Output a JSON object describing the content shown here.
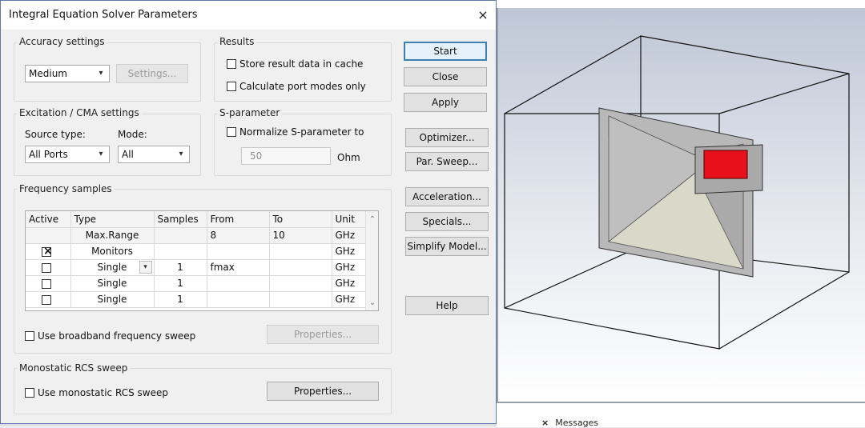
{
  "dialog": {
    "title": "Integral Equation Solver Parameters",
    "close_icon": "×"
  },
  "accuracy": {
    "label": "Accuracy settings",
    "value": "Medium",
    "settings_button": "Settings..."
  },
  "excitation": {
    "label": "Excitation / CMA settings",
    "source_type_label": "Source type:",
    "source_type_value": "All Ports",
    "mode_label": "Mode:",
    "mode_value": "All"
  },
  "results": {
    "label": "Results",
    "store_cache": "Store result data in cache",
    "calc_port_modes": "Calculate port modes only"
  },
  "sparameter": {
    "label": "S-parameter",
    "normalize_label": "Normalize S-parameter to",
    "value": "50",
    "unit": "Ohm"
  },
  "frequency": {
    "label": "Frequency samples",
    "columns": [
      "Active",
      "Type",
      "Samples",
      "From",
      "To",
      "Unit"
    ],
    "rows": [
      {
        "type": "Max.Range",
        "samples": "",
        "from": "8",
        "to": "10",
        "unit": "GHz"
      },
      {
        "type": "Monitors",
        "samples": "",
        "from": "",
        "to": "",
        "unit": "GHz",
        "checked": true
      },
      {
        "type": "Single",
        "samples": "1",
        "from": "fmax",
        "to": "",
        "unit": "GHz",
        "checked": false
      },
      {
        "type": "Single",
        "samples": "1",
        "from": "",
        "to": "",
        "unit": "GHz",
        "checked": false
      },
      {
        "type": "Single",
        "samples": "1",
        "from": "",
        "to": "",
        "unit": "GHz",
        "checked": false
      }
    ],
    "broadband_label": "Use broadband frequency sweep",
    "properties_button": "Properties..."
  },
  "rcs": {
    "label": "Monostatic RCS sweep",
    "use_label": "Use monostatic RCS sweep",
    "properties_button": "Properties..."
  },
  "buttons": {
    "start": "Start",
    "close": "Close",
    "apply": "Apply",
    "optimizer": "Optimizer...",
    "par_sweep": "Par. Sweep...",
    "acceleration": "Acceleration...",
    "specials": "Specials...",
    "simplify": "Simplify Model...",
    "help": "Help"
  },
  "bottom": {
    "close_icon": "×",
    "messages": "Messages"
  },
  "colors": {
    "dialog_bg": "#f0f0f0",
    "accent": "#3c7fb1",
    "port_red": "#e8101a"
  }
}
